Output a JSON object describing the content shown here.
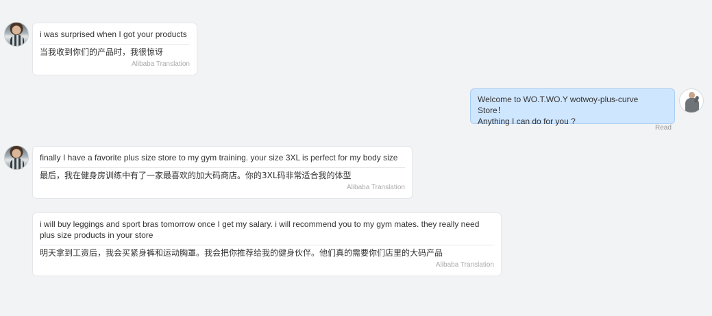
{
  "messages": [
    {
      "original": "i was surprised when I got your products",
      "translation": "当我收到你们的产品时，我很惊讶",
      "credit": "Alibaba Translation"
    },
    {
      "line1": "Welcome to WO.T.WO.Y wotwoy-plus-curve Store！",
      "line2": "Anything I can do for you ?",
      "status": "Read"
    },
    {
      "original": "finally I have a favorite plus size store to my gym training. your size 3XL is perfect for my body size",
      "translation": "最后，我在健身房训练中有了一家最喜欢的加大码商店。你的3XL码非常适合我的体型",
      "credit": "Alibaba Translation"
    },
    {
      "original": "i will buy leggings and sport bras tomorrow once I get my salary. i will recommend you to my gym mates. they really need plus size products in your store",
      "translation": "明天拿到工资后，我会买紧身裤和运动胸罩。我会把你推荐给我的健身伙伴。他们真的需要你们店里的大码产品",
      "credit": "Alibaba Translation"
    }
  ]
}
